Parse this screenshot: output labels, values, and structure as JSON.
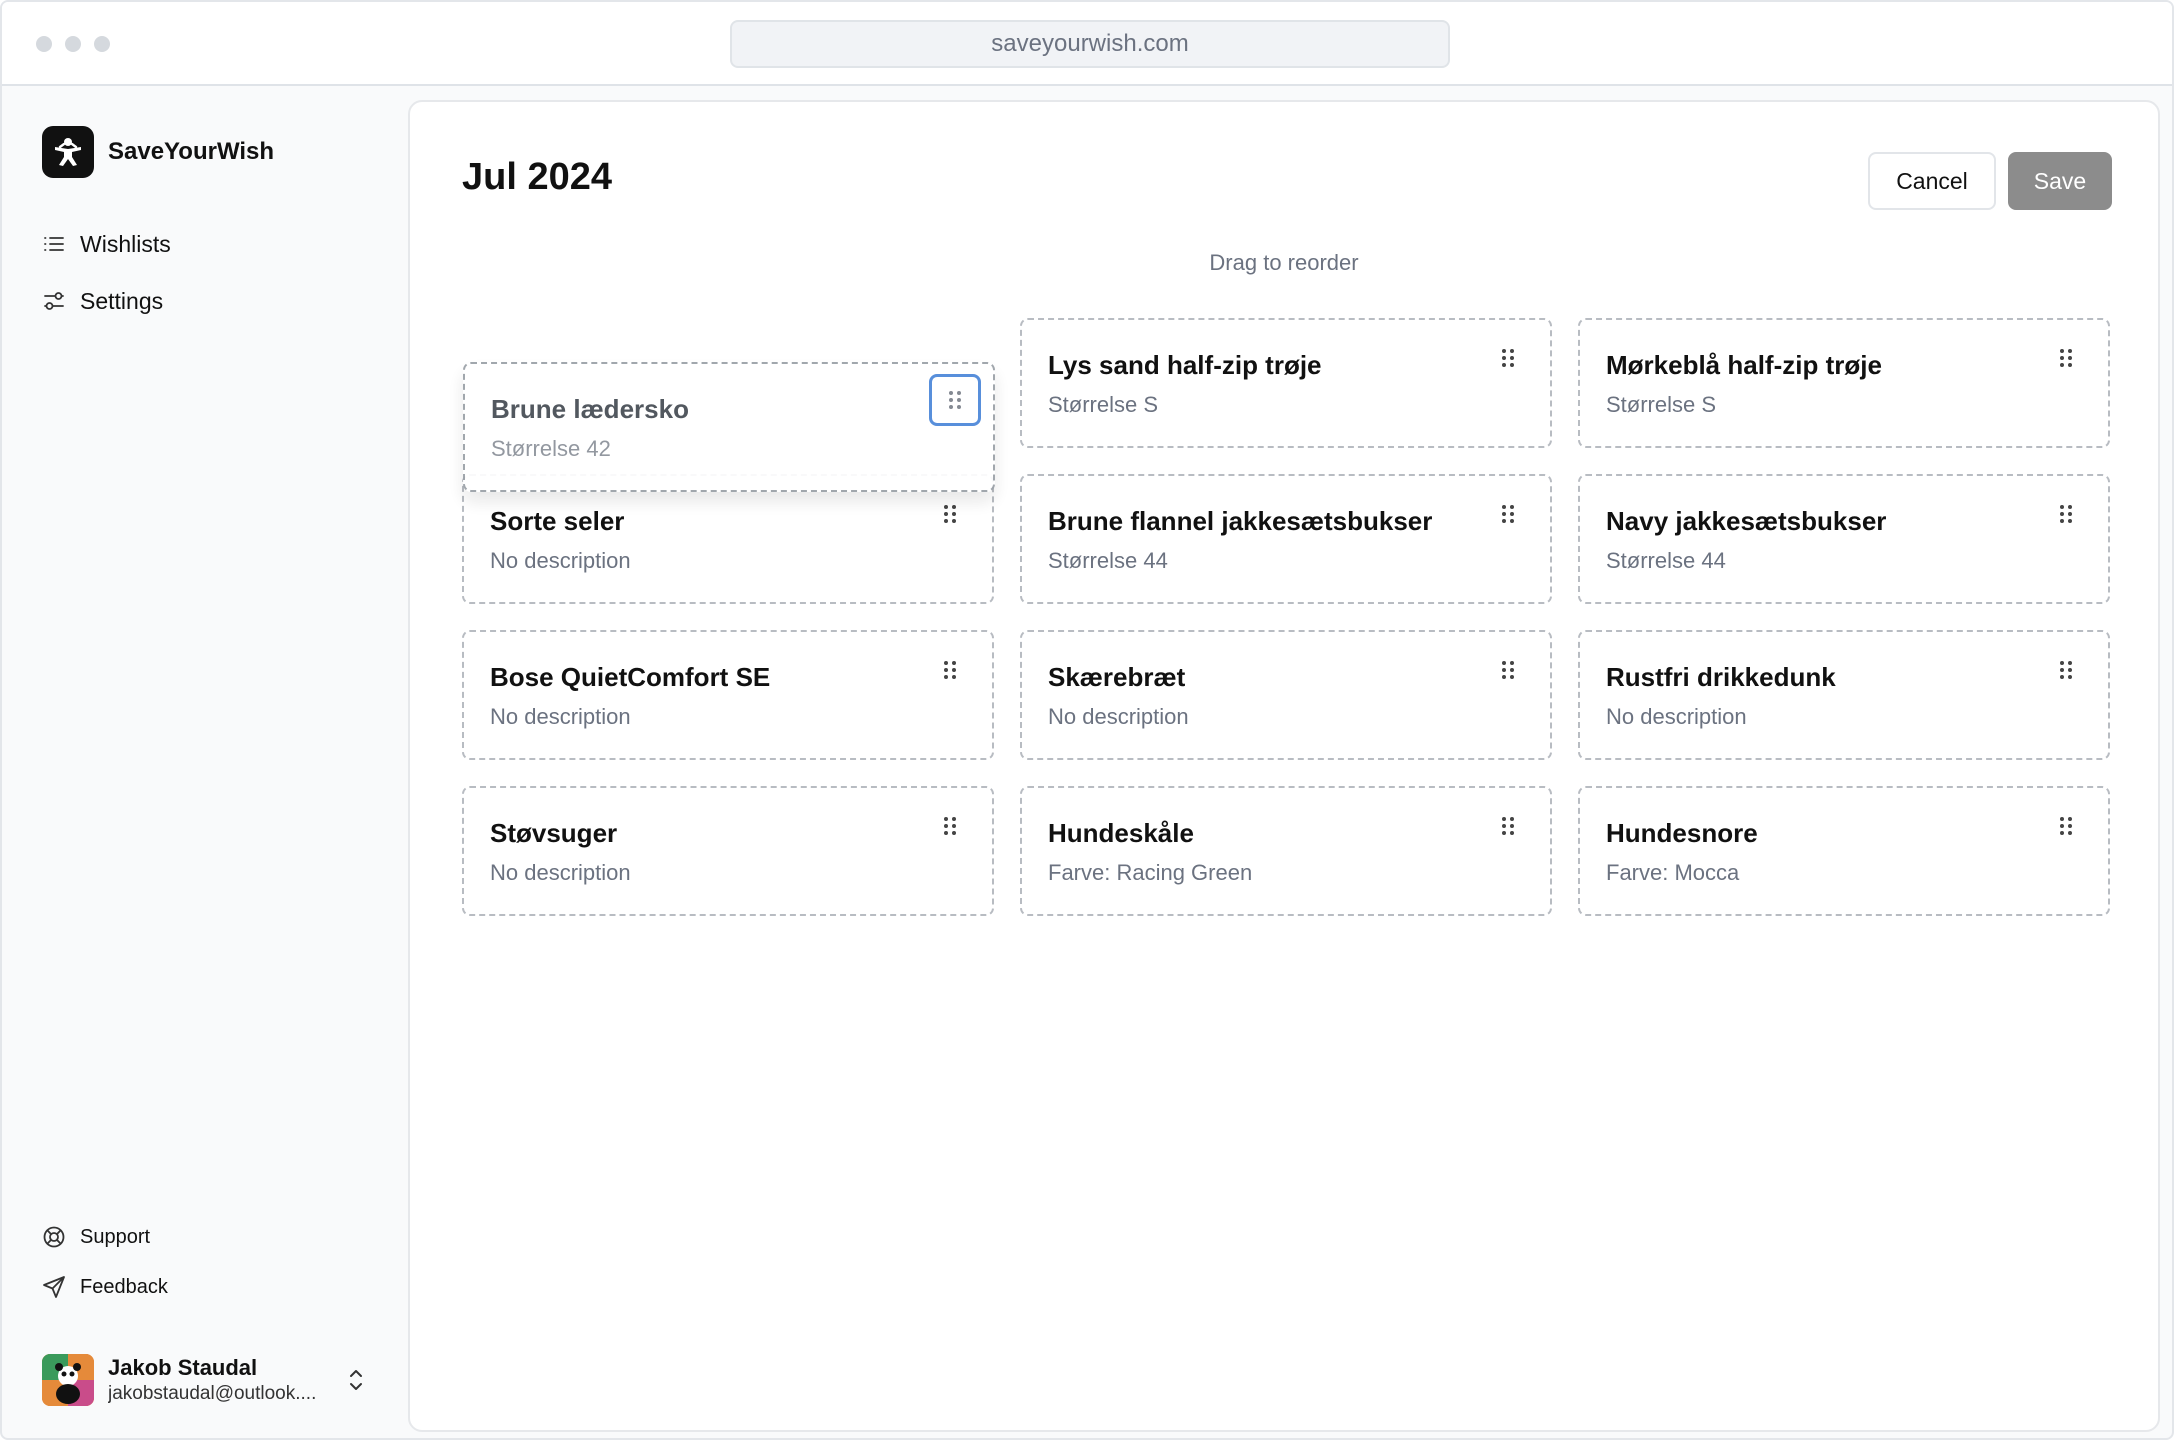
{
  "browser": {
    "url": "saveyourwish.com"
  },
  "sidebar": {
    "brand": "SaveYourWish",
    "nav": [
      {
        "label": "Wishlists",
        "icon": "list-icon"
      },
      {
        "label": "Settings",
        "icon": "sliders-icon"
      }
    ],
    "bottom_links": [
      {
        "label": "Support",
        "icon": "lifebuoy-icon"
      },
      {
        "label": "Feedback",
        "icon": "send-icon"
      }
    ],
    "user": {
      "name": "Jakob Staudal",
      "email": "jakobstaudal@outlook...."
    }
  },
  "main": {
    "title": "Jul 2024",
    "cancel_label": "Cancel",
    "save_label": "Save",
    "hint": "Drag to reorder",
    "items": [
      {
        "title": "Brune lædersko",
        "description": "Størrelse 42",
        "state": "dragging"
      },
      {
        "title": "Lys sand half-zip trøje",
        "description": "Størrelse S"
      },
      {
        "title": "Mørkeblå half-zip trøje",
        "description": "Størrelse S"
      },
      {
        "title": "Sorte seler",
        "description": "No description"
      },
      {
        "title": "Brune flannel jakkesætsbukser",
        "description": "Størrelse 44"
      },
      {
        "title": "Navy jakkesætsbukser",
        "description": "Størrelse 44"
      },
      {
        "title": "Bose QuietComfort SE",
        "description": "No description"
      },
      {
        "title": "Skærebræt",
        "description": "No description"
      },
      {
        "title": "Rustfri drikkedunk",
        "description": "No description"
      },
      {
        "title": "Støvsuger",
        "description": "No description"
      },
      {
        "title": "Hundeskåle",
        "description": "Farve: Racing Green"
      },
      {
        "title": "Hundesnore",
        "description": "Farve: Mocca"
      }
    ]
  },
  "colors": {
    "save_disabled": "#8c8c8c",
    "drag_focus": "#4a86d9",
    "muted_text": "#6b7280"
  }
}
